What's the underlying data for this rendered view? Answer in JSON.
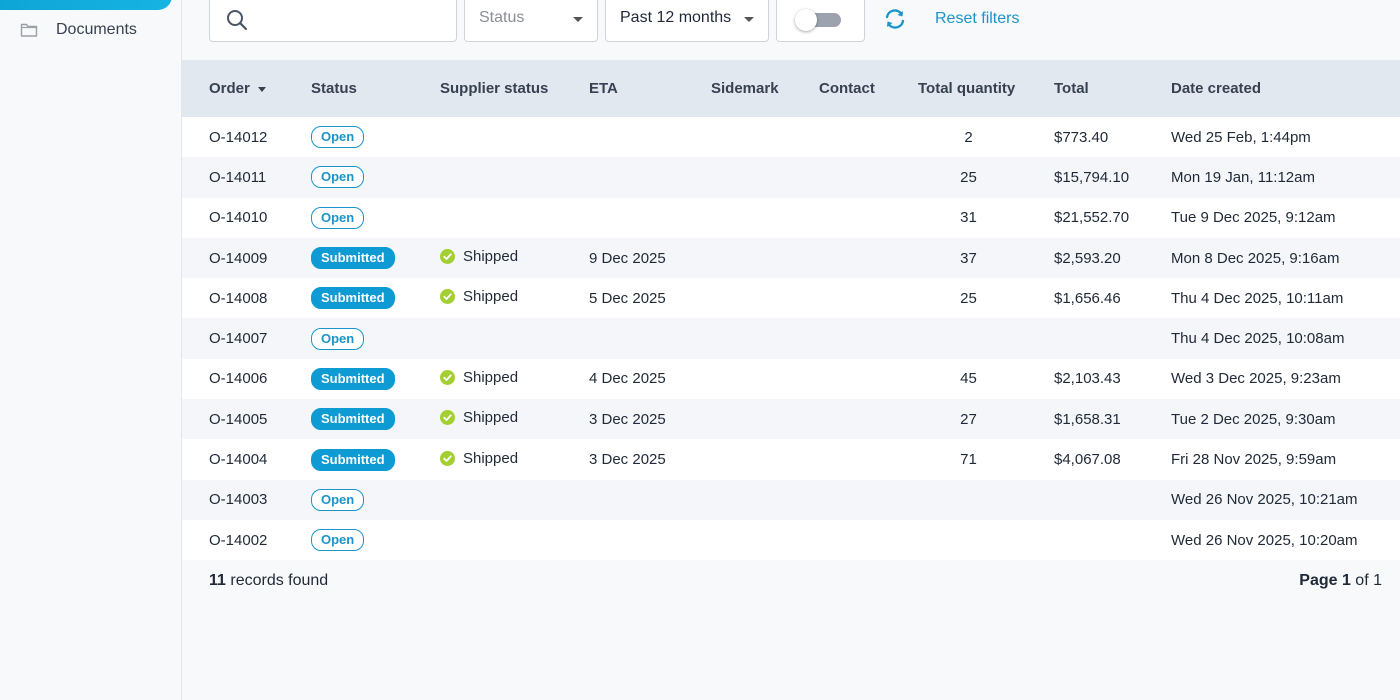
{
  "sidebar": {
    "items": [
      {
        "label": "Documents",
        "icon": "folder-icon"
      }
    ]
  },
  "filters": {
    "search": {
      "placeholder": "",
      "value": ""
    },
    "status": {
      "placeholder": "Status"
    },
    "date_range": {
      "value": "Past 12 months"
    },
    "toggle": {
      "on": false
    },
    "reset_label": "Reset filters"
  },
  "table": {
    "columns": [
      "Order",
      "Status",
      "Supplier status",
      "ETA",
      "Sidemark",
      "Contact",
      "Total quantity",
      "Total",
      "Date created"
    ],
    "rows": [
      {
        "order": "O-14012",
        "status": "Open",
        "supplier_status": "",
        "eta": "",
        "sidemark": "",
        "contact": "",
        "qty": "2",
        "total": "$773.40",
        "date": "Wed 25 Feb, 1:44pm"
      },
      {
        "order": "O-14011",
        "status": "Open",
        "supplier_status": "",
        "eta": "",
        "sidemark": "",
        "contact": "",
        "qty": "25",
        "total": "$15,794.10",
        "date": "Mon 19 Jan, 11:12am"
      },
      {
        "order": "O-14010",
        "status": "Open",
        "supplier_status": "",
        "eta": "",
        "sidemark": "",
        "contact": "",
        "qty": "31",
        "total": "$21,552.70",
        "date": "Tue 9 Dec 2025, 9:12am"
      },
      {
        "order": "O-14009",
        "status": "Submitted",
        "supplier_status": "Shipped",
        "eta": "9 Dec 2025",
        "sidemark": "",
        "contact": "",
        "qty": "37",
        "total": "$2,593.20",
        "date": "Mon 8 Dec 2025, 9:16am"
      },
      {
        "order": "O-14008",
        "status": "Submitted",
        "supplier_status": "Shipped",
        "eta": "5 Dec 2025",
        "sidemark": "",
        "contact": "",
        "qty": "25",
        "total": "$1,656.46",
        "date": "Thu 4 Dec 2025, 10:11am"
      },
      {
        "order": "O-14007",
        "status": "Open",
        "supplier_status": "",
        "eta": "",
        "sidemark": "",
        "contact": "",
        "qty": "",
        "total": "",
        "date": "Thu 4 Dec 2025, 10:08am"
      },
      {
        "order": "O-14006",
        "status": "Submitted",
        "supplier_status": "Shipped",
        "eta": "4 Dec 2025",
        "sidemark": "",
        "contact": "",
        "qty": "45",
        "total": "$2,103.43",
        "date": "Wed 3 Dec 2025, 9:23am"
      },
      {
        "order": "O-14005",
        "status": "Submitted",
        "supplier_status": "Shipped",
        "eta": "3 Dec 2025",
        "sidemark": "",
        "contact": "",
        "qty": "27",
        "total": "$1,658.31",
        "date": "Tue 2 Dec 2025, 9:30am"
      },
      {
        "order": "O-14004",
        "status": "Submitted",
        "supplier_status": "Shipped",
        "eta": "3 Dec 2025",
        "sidemark": "",
        "contact": "",
        "qty": "71",
        "total": "$4,067.08",
        "date": "Fri 28 Nov 2025, 9:59am"
      },
      {
        "order": "O-14003",
        "status": "Open",
        "supplier_status": "",
        "eta": "",
        "sidemark": "",
        "contact": "",
        "qty": "",
        "total": "",
        "date": "Wed 26 Nov 2025, 10:21am"
      },
      {
        "order": "O-14002",
        "status": "Open",
        "supplier_status": "",
        "eta": "",
        "sidemark": "",
        "contact": "",
        "qty": "",
        "total": "",
        "date": "Wed 26 Nov 2025, 10:20am"
      }
    ]
  },
  "footer": {
    "record_count": "11",
    "records_suffix": " records found",
    "page_prefix": "Page ",
    "page_current": "1",
    "page_of": " of ",
    "page_total": "1"
  },
  "colors": {
    "accent": "#1b95c9",
    "submitted_bg": "#0e9ad2",
    "shipped_check": "#a3cf34",
    "header_bg": "#e2e8f0"
  }
}
